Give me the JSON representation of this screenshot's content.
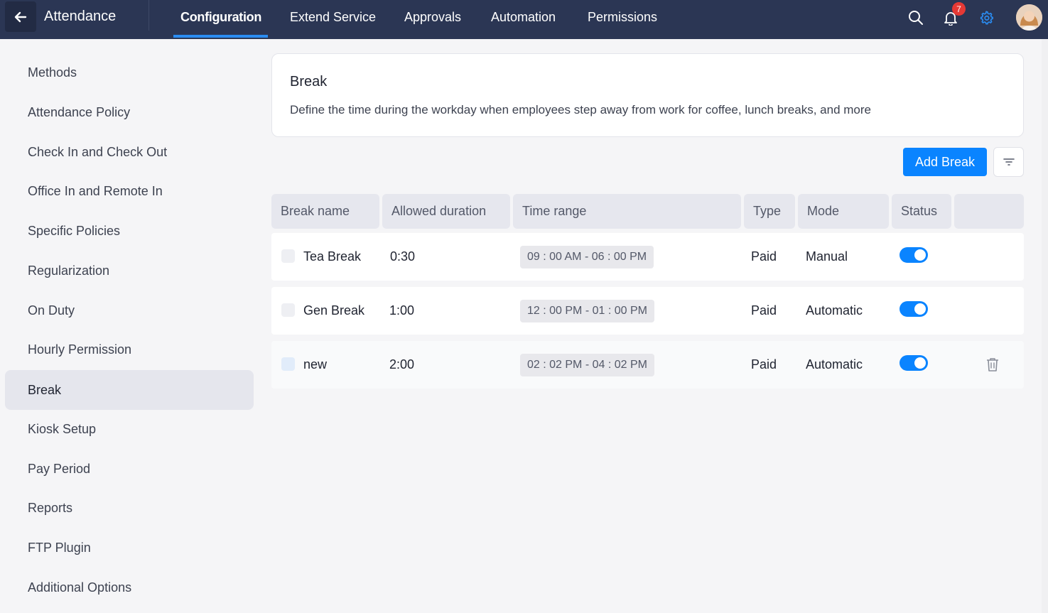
{
  "app": {
    "title": "Attendance"
  },
  "nav": {
    "tabs": [
      {
        "label": "Configuration",
        "active": true
      },
      {
        "label": "Extend Service"
      },
      {
        "label": "Approvals"
      },
      {
        "label": "Automation"
      },
      {
        "label": "Permissions"
      }
    ]
  },
  "topbar": {
    "icons": [
      "back-arrow-icon",
      "search-icon",
      "bell-icon",
      "gear-icon",
      "avatar"
    ],
    "notification_count": "7"
  },
  "sidebar": {
    "items": [
      {
        "label": "Methods"
      },
      {
        "label": "Attendance Policy"
      },
      {
        "label": "Check In and Check Out"
      },
      {
        "label": "Office In and Remote In"
      },
      {
        "label": "Specific Policies"
      },
      {
        "label": "Regularization"
      },
      {
        "label": "On Duty"
      },
      {
        "label": "Hourly Permission"
      },
      {
        "label": "Break",
        "active": true
      },
      {
        "label": "Kiosk Setup"
      },
      {
        "label": "Pay Period"
      },
      {
        "label": "Reports"
      },
      {
        "label": "FTP Plugin"
      },
      {
        "label": "Additional Options"
      }
    ]
  },
  "header": {
    "title": "Break",
    "description": "Define the time during the workday when employees step away from work for coffee, lunch breaks, and more"
  },
  "toolbar": {
    "add_label": "Add Break",
    "filter_icon": "filter-icon"
  },
  "table": {
    "columns": [
      "Break name",
      "Allowed duration",
      "Time range",
      "Type",
      "Mode",
      "Status"
    ],
    "rows": [
      {
        "name": "Tea Break",
        "duration": "0:30",
        "time_range": "09 : 00 AM - 06 : 00 PM",
        "type": "Paid",
        "mode": "Manual",
        "status_on": true
      },
      {
        "name": "Gen Break",
        "duration": "1:00",
        "time_range": "12 : 00 PM - 01 : 00 PM",
        "type": "Paid",
        "mode": "Automatic",
        "status_on": true
      },
      {
        "name": "new",
        "duration": "2:00",
        "time_range": "02 : 02 PM - 04 : 02 PM",
        "type": "Paid",
        "mode": "Automatic",
        "status_on": true,
        "row_icon": "trash-icon"
      }
    ]
  },
  "colors": {
    "topbar": "#2b3654",
    "accent": "#0a84ff",
    "active_tab_underline": "#2a8cf2",
    "badge": "#e53935"
  }
}
